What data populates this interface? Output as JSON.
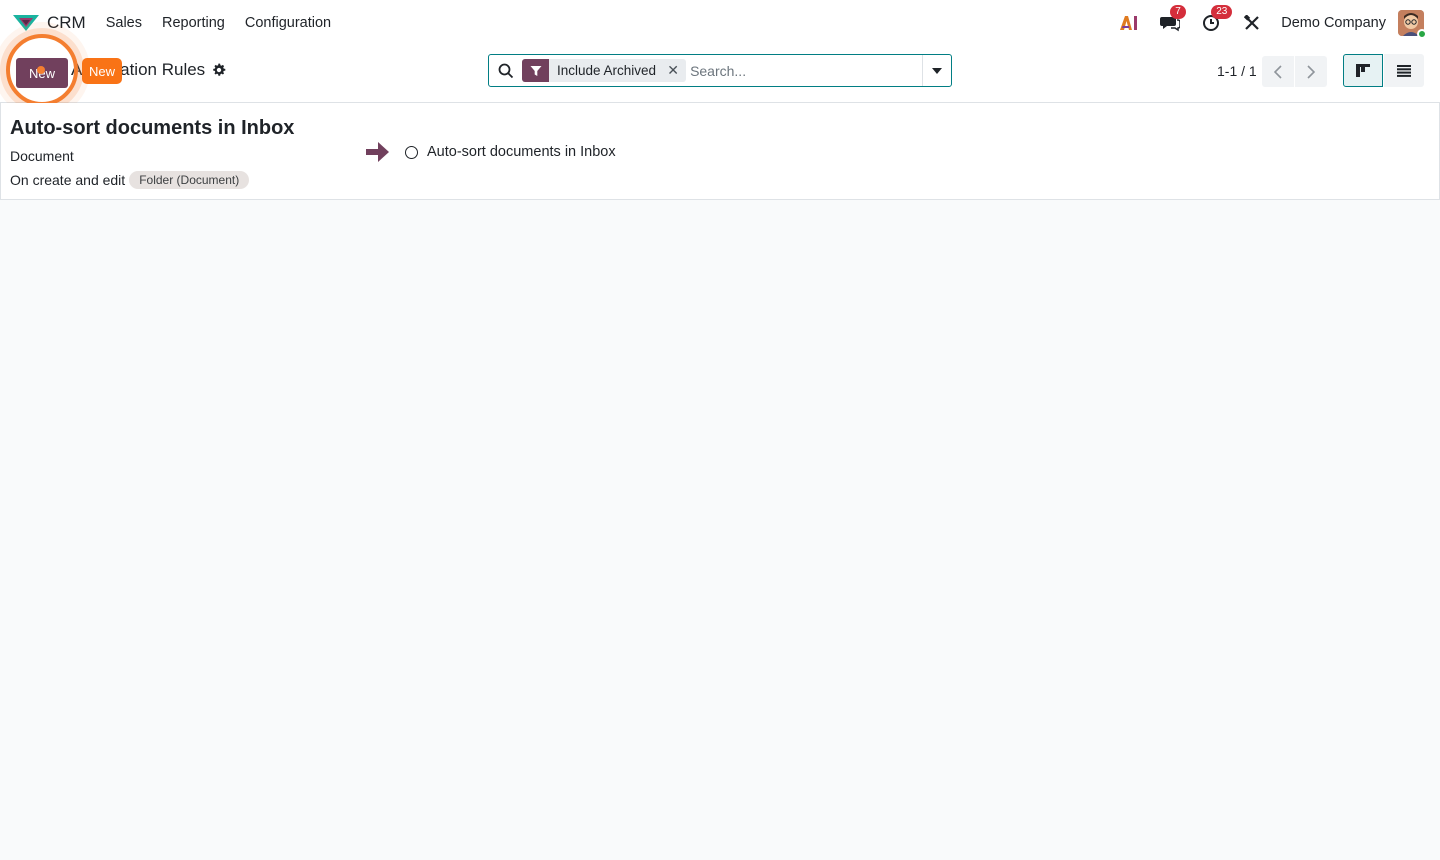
{
  "navbar": {
    "app_name": "CRM",
    "menu": [
      "Sales",
      "Reporting",
      "Configuration"
    ],
    "messages_count": "7",
    "activities_count": "23",
    "company": "Demo Company"
  },
  "control_panel": {
    "new_button": "New",
    "tooltip": "New",
    "breadcrumb": "Automation Rules",
    "search": {
      "facet_label": "Include Archived",
      "placeholder": "Search..."
    },
    "pager": "1-1 / 1"
  },
  "record": {
    "title": "Auto-sort documents in Inbox",
    "model": "Document",
    "trigger": "On create and edit",
    "tag": "Folder (Document)",
    "action": "Auto-sort documents in Inbox"
  },
  "colors": {
    "primary": "#71405d",
    "accent": "#017e84",
    "highlight": "#f97316",
    "badge": "#d42e3b"
  }
}
